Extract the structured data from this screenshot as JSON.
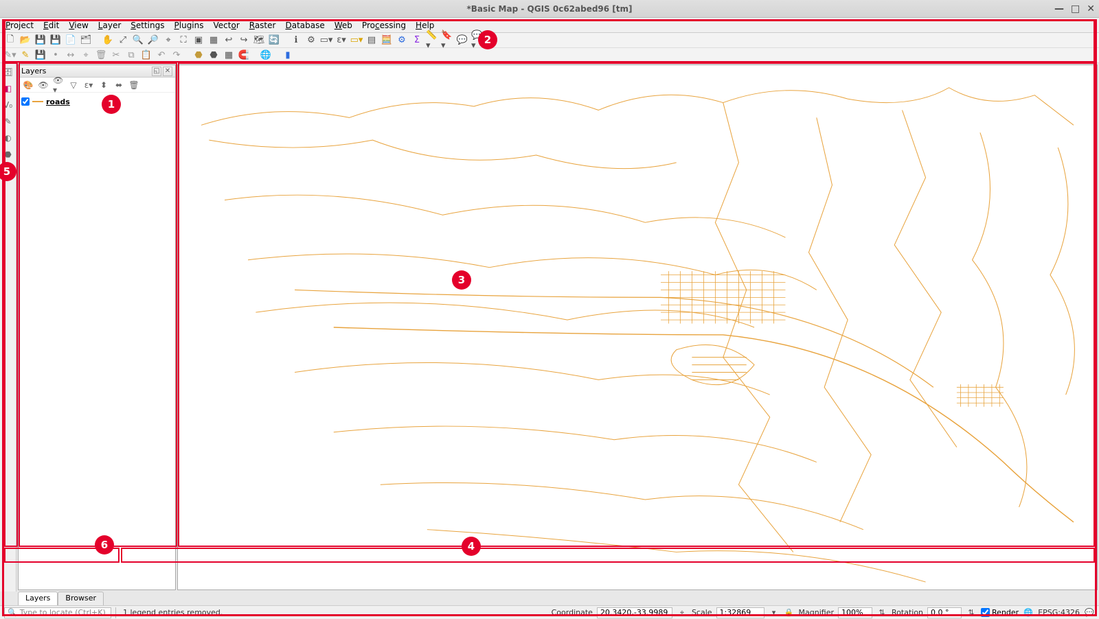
{
  "window": {
    "title": "*Basic Map - QGIS 0c62abed96 [tm]"
  },
  "menu": {
    "project": {
      "label": "Project",
      "ul": "P"
    },
    "edit": {
      "label": "Edit",
      "ul": "E"
    },
    "view": {
      "label": "View",
      "ul": "V"
    },
    "layer": {
      "label": "Layer",
      "ul": "L"
    },
    "settings": {
      "label": "Settings",
      "ul": "S"
    },
    "plugins": {
      "label": "Plugins",
      "ul": "P"
    },
    "vector": {
      "label": "Vector",
      "ul": "V"
    },
    "raster": {
      "label": "Raster",
      "ul": "R"
    },
    "database": {
      "label": "Database",
      "ul": "D"
    },
    "web": {
      "label": "Web",
      "ul": "W"
    },
    "processing": {
      "label": "Processing",
      "ul": "P"
    },
    "help": {
      "label": "Help",
      "ul": "H"
    }
  },
  "layers_panel": {
    "title": "Layers",
    "item0": {
      "name": "roads",
      "checked": true
    }
  },
  "tabs": {
    "layers": "Layers",
    "browser": "Browser"
  },
  "locator": {
    "placeholder": "Type to locate (Ctrl+K)"
  },
  "status": {
    "message": "1 legend entries removed.",
    "coordinate_label": "Coordinate",
    "coordinate_value": "20.3420,-33.9989",
    "scale_label": "Scale",
    "scale_value": "1:32869",
    "magnifier_label": "Magnifier",
    "magnifier_value": "100%",
    "rotation_label": "Rotation",
    "rotation_value": "0.0 °",
    "render_label": "Render",
    "crs": "EPSG:4326"
  },
  "annotations": {
    "n1": "1",
    "n2": "2",
    "n3": "3",
    "n4": "4",
    "n5": "5",
    "n6": "6"
  }
}
